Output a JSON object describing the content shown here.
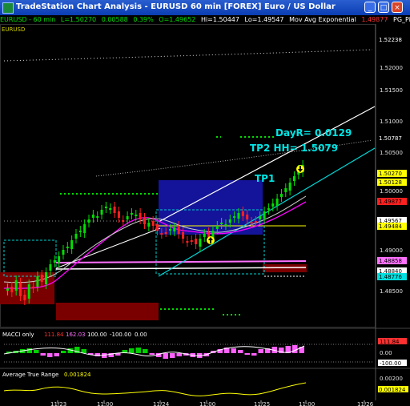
{
  "titlebar": {
    "title": "TradeStation Chart Analysis - EURUSD 60 min [FOREX] Euro / US Dollar",
    "minimize": "_",
    "maximize": "□",
    "close": "×"
  },
  "infobar": {
    "symbol": "EURUSD - 60 min",
    "last": "L=1.50270",
    "change": "0.00588",
    "pct": "0.39%",
    "open": "O=1.49652",
    "high": "Hi=1.50447",
    "low": "Lo=1.49547",
    "indicator": "Mov Avg Exponential",
    "indicator_value": "1.49877",
    "pivot": "PG_Pivo"
  },
  "price_pane": {
    "symbol_label": "EURUSD",
    "day_range": "DayR= 0.0129",
    "tp2": "TP2 HH= 1.5079",
    "tp1": "TP1",
    "axis_labels": [
      "1.52238",
      "1.52000",
      "1.51500",
      "1.51000",
      "1.50787",
      "1.50500",
      "1.50270",
      "1.50128",
      "1.50000",
      "1.49877",
      "1.49567",
      "1.49484",
      "1.49000",
      "1.48858",
      "1.48840",
      "1.48776",
      "1.48500"
    ],
    "price_tags": [
      {
        "text": "1.52238",
        "bg": "#000000",
        "fg": "#ffffff"
      },
      {
        "text": "1.50787",
        "bg": "#000000",
        "fg": "#ffffff"
      },
      {
        "text": "1.50270",
        "bg": "#ffff00",
        "fg": "#000000"
      },
      {
        "text": "1.50128",
        "bg": "#ffff00",
        "fg": "#000000"
      },
      {
        "text": "1.49877",
        "bg": "#ff2020",
        "fg": "#000000"
      },
      {
        "text": "1.49567",
        "bg": "#ffffff",
        "fg": "#000000"
      },
      {
        "text": "1.49484",
        "bg": "#ffff00",
        "fg": "#000000"
      },
      {
        "text": "1.48858",
        "bg": "#ff70ff",
        "fg": "#000000"
      },
      {
        "text": "1.48840",
        "bg": "#ffffff",
        "fg": "#000000"
      },
      {
        "text": "1.48776",
        "bg": "#00e0e0",
        "fg": "#000000"
      }
    ]
  },
  "macci_pane": {
    "label": "MACCI only",
    "v1": "111.84",
    "v2": "162.03",
    "v3": "100.00",
    "v4": "-100.00",
    "v5": "0.00",
    "axis_labels": [
      "111.84",
      "0.00",
      "-100.00"
    ]
  },
  "atr_pane": {
    "label": "Average True Range",
    "value": "0.001824",
    "axis_labels": [
      "0.00200",
      "0.001824"
    ]
  },
  "time_axis": [
    "11/23",
    "11:00",
    "11/24",
    "11:00",
    "11/25",
    "11:00",
    "11/26"
  ],
  "colors": {
    "up_candle": "#00e000",
    "down_candle": "#ff2020",
    "price_box": "#1a1aa0",
    "ema": "#ff00ff",
    "annotation": "#00e5e5",
    "trendline_up": "#ffffff",
    "trendline_cyan": "#00e0e0"
  },
  "icons": [
    "app-icon",
    "up-arrow-signal-icon",
    "down-arrow-signal-icon"
  ]
}
